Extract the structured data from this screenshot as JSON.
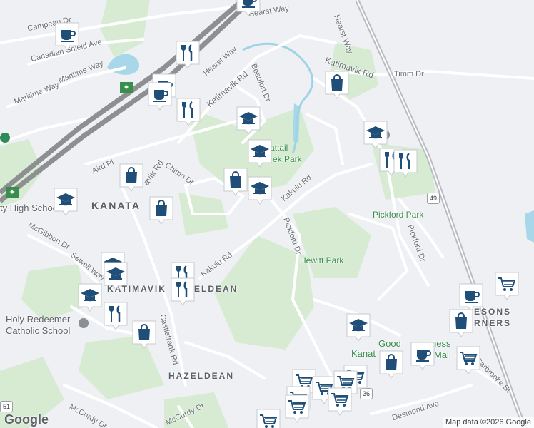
{
  "map": {
    "attribution": "Map data ©2026 Google",
    "logo": "Google"
  },
  "labels": {
    "streets": [
      {
        "text": "Campeau Dr",
        "name": "street-campeau-dr"
      },
      {
        "text": "Canadian Shield Ave",
        "name": "street-canadian-shield-ave"
      },
      {
        "text": "Maritime Way",
        "name": "street-maritime-way-north"
      },
      {
        "text": "Maritime Way",
        "name": "street-maritime-way-south"
      },
      {
        "text": "Hearst Way",
        "name": "street-hearst-way-west"
      },
      {
        "text": "Hearst Way",
        "name": "street-hearst-way-top"
      },
      {
        "text": "Hearst Way",
        "name": "street-hearst-way-east"
      },
      {
        "text": "Katimavik Rd",
        "name": "street-katimavik-rd-west"
      },
      {
        "text": "Katimavik Rd",
        "name": "street-katimavik-rd-east"
      },
      {
        "text": "Beaufort Dr",
        "name": "street-beaufort-dr"
      },
      {
        "text": "Timm Dr",
        "name": "street-timm-dr"
      },
      {
        "text": "Aird Pl",
        "name": "street-aird-pl"
      },
      {
        "text": "Chimo Dr",
        "name": "street-chimo-dr"
      },
      {
        "text": "avik Rd",
        "name": "street-katimavik-rd-diag"
      },
      {
        "text": "Kakulu Rd",
        "name": "street-kakulu-rd-north"
      },
      {
        "text": "Kakulu Rd",
        "name": "street-kakulu-rd-south"
      },
      {
        "text": "Pickford Dr",
        "name": "street-pickford-dr"
      },
      {
        "text": "Pickford Dr",
        "name": "street-pickford-dr-east"
      },
      {
        "text": "McGibbon Dr",
        "name": "street-mcgibbon-dr"
      },
      {
        "text": "Sewell Way",
        "name": "street-sewell-way"
      },
      {
        "text": "Castlefrank Rd",
        "name": "street-castlefrank-rd"
      },
      {
        "text": "McCurdy Dr",
        "name": "street-mccurdy-dr-south"
      },
      {
        "text": "McCurdy Dr",
        "name": "street-mccurdy-dr"
      },
      {
        "text": "Carbrooke St",
        "name": "street-carbrooke-st"
      },
      {
        "text": "Desmond Ave",
        "name": "street-desmond-ave"
      }
    ],
    "parks": [
      {
        "text": "attail",
        "name": "park-cattail-line1"
      },
      {
        "text": "ek Park",
        "name": "park-cattail-line2"
      },
      {
        "text": "Pickford Park",
        "name": "park-pickford"
      },
      {
        "text": "Hewitt Park",
        "name": "park-hewitt"
      }
    ],
    "districts": [
      {
        "text": "KANATA",
        "name": "district-kanata"
      },
      {
        "text": "KATIMAVIK",
        "name": "district-katimavik"
      },
      {
        "text": "ELDEAN",
        "name": "district-hazeldean-partial"
      },
      {
        "text": "HAZELDEAN",
        "name": "district-hazeldean"
      },
      {
        "text": "ESONS",
        "name": "district-glen-cairn-line1"
      },
      {
        "text": "RNERS",
        "name": "district-glen-cairn-line2"
      }
    ],
    "places": [
      {
        "text": "ty High School",
        "name": "place-high-school"
      },
      {
        "text": "Holy Redeemer",
        "name": "place-holy-redeemer-line1"
      },
      {
        "text": "Catholic School",
        "name": "place-holy-redeemer-line2"
      },
      {
        "text": "Good",
        "name": "place-good-fitness-part1"
      },
      {
        "text": "ness",
        "name": "place-good-fitness-part2"
      },
      {
        "text": "Mall",
        "name": "place-mall"
      },
      {
        "text": "Kanat",
        "name": "place-kanata-centrum"
      }
    ],
    "highways": [
      {
        "text": "49",
        "name": "hwy-49-shield"
      },
      {
        "text": "36",
        "name": "hwy-36-shield"
      },
      {
        "text": "51",
        "name": "hwy-51-shield"
      }
    ]
  },
  "markers": [
    {
      "type": "cafe",
      "icon": "coffee-cup-icon"
    },
    {
      "type": "cafe",
      "icon": "coffee-cup-icon"
    },
    {
      "type": "restaurant",
      "icon": "fork-knife-icon"
    },
    {
      "type": "cafe",
      "icon": "coffee-cup-icon"
    },
    {
      "type": "cafe",
      "icon": "coffee-cup-icon"
    },
    {
      "type": "restaurant",
      "icon": "fork-knife-icon"
    },
    {
      "type": "shopping",
      "icon": "shopping-bag-icon"
    },
    {
      "type": "school",
      "icon": "graduation-cap-icon"
    },
    {
      "type": "school",
      "icon": "graduation-cap-icon"
    },
    {
      "type": "shopping",
      "icon": "shopping-bag-icon"
    },
    {
      "type": "school",
      "icon": "graduation-cap-icon"
    },
    {
      "type": "shopping",
      "icon": "shopping-bag-icon"
    },
    {
      "type": "school",
      "icon": "graduation-cap-icon"
    },
    {
      "type": "shopping",
      "icon": "shopping-bag-icon"
    },
    {
      "type": "school",
      "icon": "graduation-cap-icon"
    },
    {
      "type": "restaurant",
      "icon": "fork-knife-icon"
    },
    {
      "type": "restaurant",
      "icon": "fork-knife-icon"
    },
    {
      "type": "school",
      "icon": "graduation-cap-icon"
    },
    {
      "type": "school",
      "icon": "graduation-cap-icon"
    },
    {
      "type": "school",
      "icon": "graduation-cap-icon"
    },
    {
      "type": "restaurant",
      "icon": "fork-knife-icon"
    },
    {
      "type": "restaurant",
      "icon": "fork-knife-icon"
    },
    {
      "type": "shopping",
      "icon": "shopping-bag-icon"
    },
    {
      "type": "school",
      "icon": "graduation-cap-icon"
    },
    {
      "type": "cafe",
      "icon": "coffee-cup-icon"
    },
    {
      "type": "shopping-cart",
      "icon": "shopping-cart-icon"
    },
    {
      "type": "shopping",
      "icon": "shopping-bag-icon"
    },
    {
      "type": "shopping-cart",
      "icon": "shopping-cart-icon"
    },
    {
      "type": "cafe",
      "icon": "coffee-cup-icon"
    },
    {
      "type": "shopping",
      "icon": "shopping-bag-icon"
    },
    {
      "type": "shopping-cart",
      "icon": "shopping-cart-icon"
    },
    {
      "type": "shopping-cart",
      "icon": "shopping-cart-icon"
    },
    {
      "type": "shopping-cart",
      "icon": "shopping-cart-icon"
    },
    {
      "type": "shopping-cart",
      "icon": "shopping-cart-icon"
    },
    {
      "type": "shopping-cart",
      "icon": "shopping-cart-icon"
    },
    {
      "type": "shopping-cart",
      "icon": "shopping-cart-icon"
    },
    {
      "type": "shopping-cart",
      "icon": "shopping-cart-icon"
    },
    {
      "type": "shopping-cart",
      "icon": "shopping-cart-icon"
    }
  ],
  "colors": {
    "marker_fill": "#1f4e79",
    "marker_bg": "#ffffff",
    "park_green": "#cfe8cc",
    "water": "#9fd3e6",
    "highway": "#8e8f93",
    "road": "#ffffff",
    "background": "#eef0f3"
  }
}
